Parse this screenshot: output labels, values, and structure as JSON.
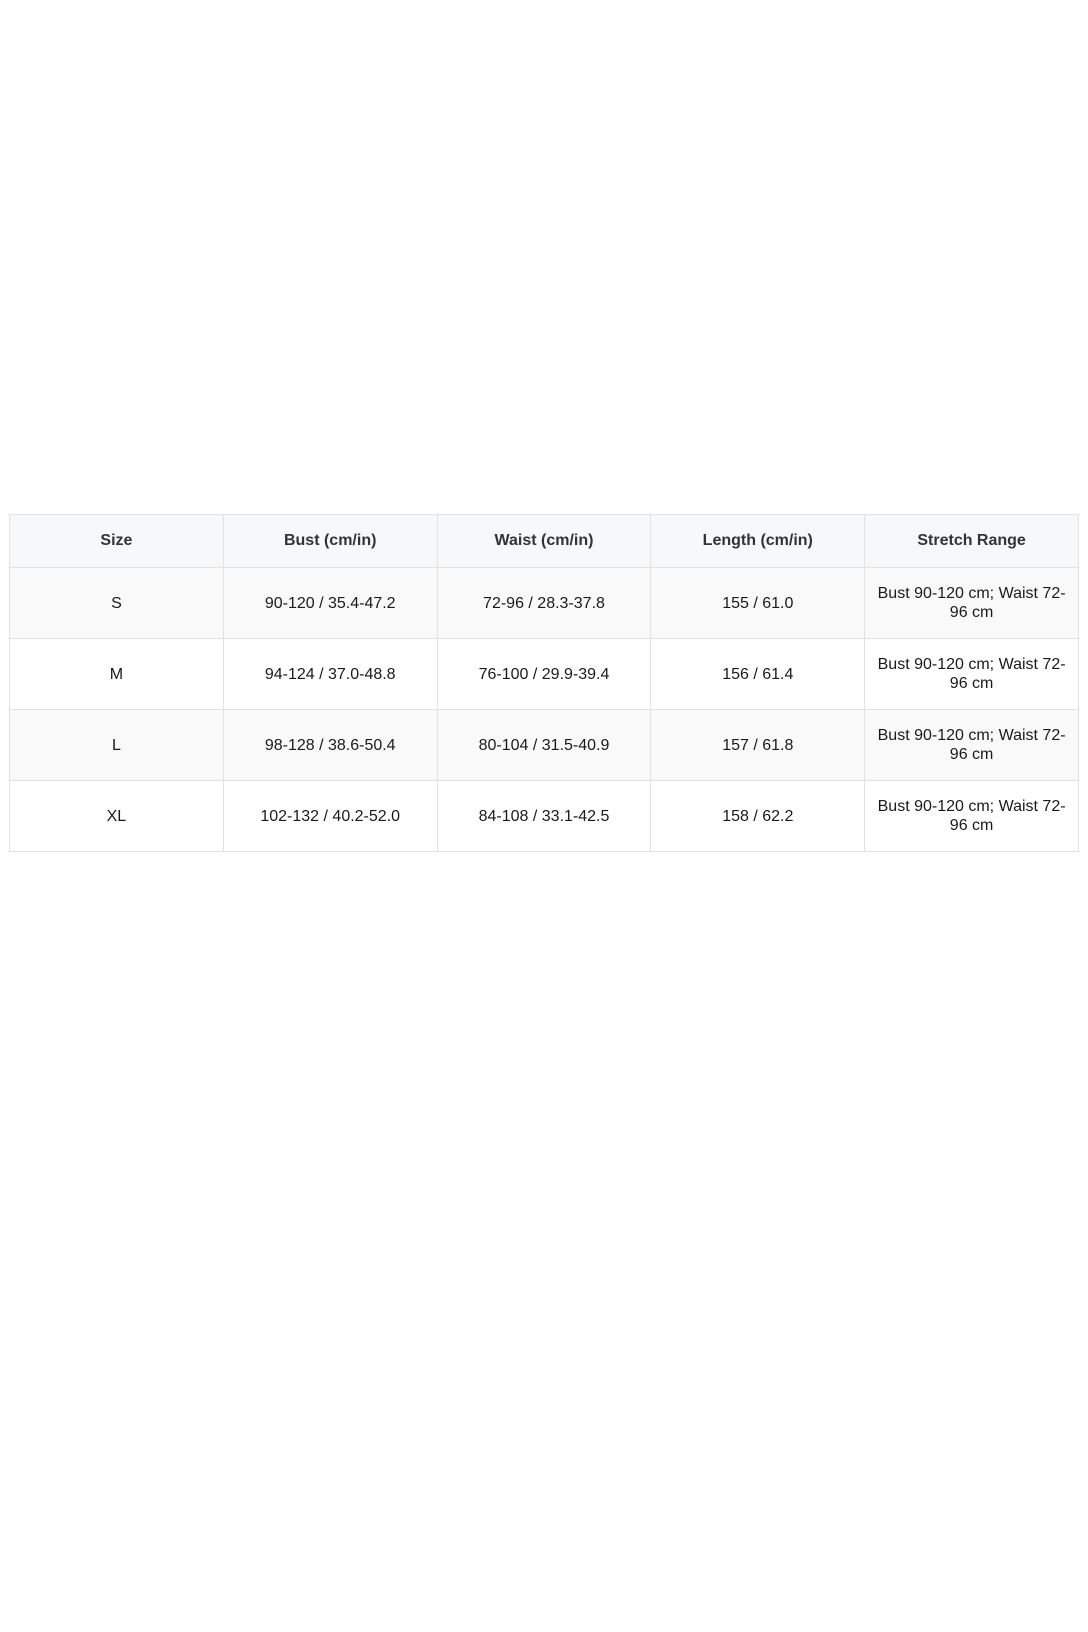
{
  "table": {
    "headers": [
      "Size",
      "Bust (cm/in)",
      "Waist (cm/in)",
      "Length (cm/in)",
      "Stretch Range"
    ],
    "rows": [
      [
        "S",
        "90-120 / 35.4-47.2",
        "72-96 / 28.3-37.8",
        "155 / 61.0",
        "Bust 90-120 cm; Waist 72-96 cm"
      ],
      [
        "M",
        "94-124 / 37.0-48.8",
        "76-100 / 29.9-39.4",
        "156 / 61.4",
        "Bust 90-120 cm; Waist 72-96 cm"
      ],
      [
        "L",
        "98-128 / 38.6-50.4",
        "80-104 / 31.5-40.9",
        "157 / 61.8",
        "Bust 90-120 cm; Waist 72-96 cm"
      ],
      [
        "XL",
        "102-132 / 40.2-52.0",
        "84-108 / 33.1-42.5",
        "158 / 62.2",
        "Bust 90-120 cm; Waist 72-96 cm"
      ]
    ]
  },
  "colors": {
    "border": "#e2e2e2",
    "header_background": "#f7f8f9",
    "row_odd_background": "#f9f9f9",
    "row_even_background": "#ffffff",
    "text": "#1a1a1a"
  }
}
